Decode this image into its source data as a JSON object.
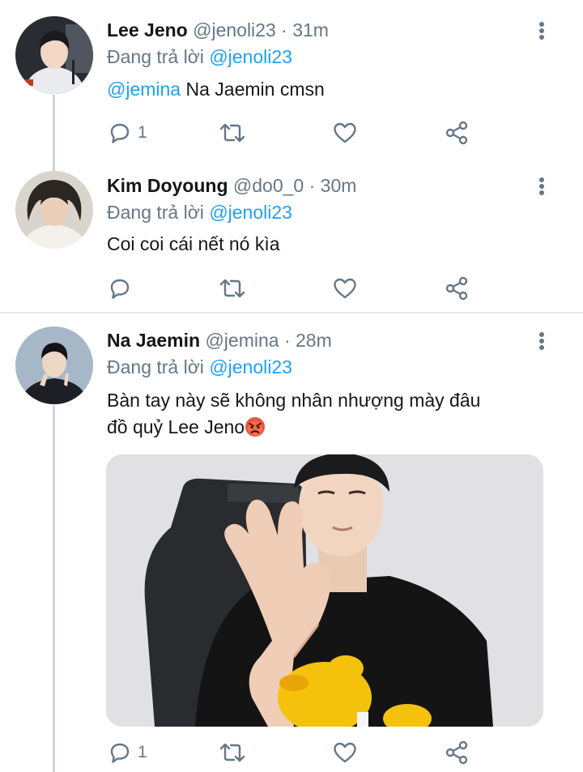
{
  "tweets": [
    {
      "name": "Lee Jeno",
      "handle": "@jenoli23",
      "time": "31m",
      "replying_prefix": "Đang trả lời",
      "replying_to": "@jenoli23",
      "mention": "@jemina",
      "text": "Na Jaemin cmsn",
      "reply_count": "1"
    },
    {
      "name": "Kim Doyoung",
      "handle": "@do0_0",
      "time": "30m",
      "replying_prefix": "Đang trả lời",
      "replying_to": "@jenoli23",
      "text": "Coi coi cái nết nó kìa",
      "reply_count": ""
    },
    {
      "name": "Na Jaemin",
      "handle": "@jemina",
      "time": "28m",
      "replying_prefix": "Đang trả lời",
      "replying_to": "@jenoli23",
      "text_line1": "Bàn tay này sẽ không nhân nhượng mày đâu",
      "text_line2": "đồ quỷ Lee Jeno",
      "emoji": "angry-face-emoji",
      "reply_count": "1"
    }
  ],
  "icons": [
    "reply-icon",
    "retweet-icon",
    "like-icon",
    "share-icon",
    "more-icon"
  ],
  "colors": {
    "accent": "#1da1f2",
    "secondary": "#657786",
    "thread_line": "#ccd6dd",
    "text": "#14171a"
  }
}
